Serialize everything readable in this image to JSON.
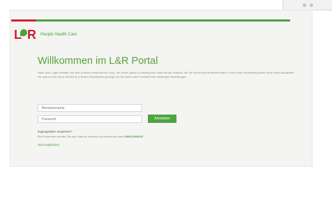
{
  "brand": {
    "tagline": "People Health Care",
    "logo_letters": {
      "l": "L",
      "r": "R"
    }
  },
  "page": {
    "title": "Willkommen im L&R Portal",
    "intro": "Nach dem Login befinden Sie sich in Ihrem persönlichen Shop. Sie sehen gleich zu Anfang eine Liste mit den Artikeln, die Sie schon einmal bestellt haben. Auch seine Bestellung Artikel diese dann aktualisiert. Sie sparen Zeit, denn mit BOLD in einem Strichbutton gezeigt und Sie sehen alle Produkte Ihrer bisherigen Bestellungen."
  },
  "login": {
    "username_placeholder": "Benutzername",
    "password_placeholder": "Passwort",
    "submit_label": "Anmelden"
  },
  "help": {
    "forgot_heading": "Zugangsdaten vergessen?",
    "forgot_text": "Bei Problemen wenden Sie sich bitte an unseren Kundenservice unter",
    "phone": "0800-0000000",
    "register_label": "Jetzt registrieren"
  },
  "colors": {
    "brand_red": "#d21e2c",
    "brand_green": "#4aa13b"
  },
  "icons": {
    "corner": "window-controls-icon"
  }
}
